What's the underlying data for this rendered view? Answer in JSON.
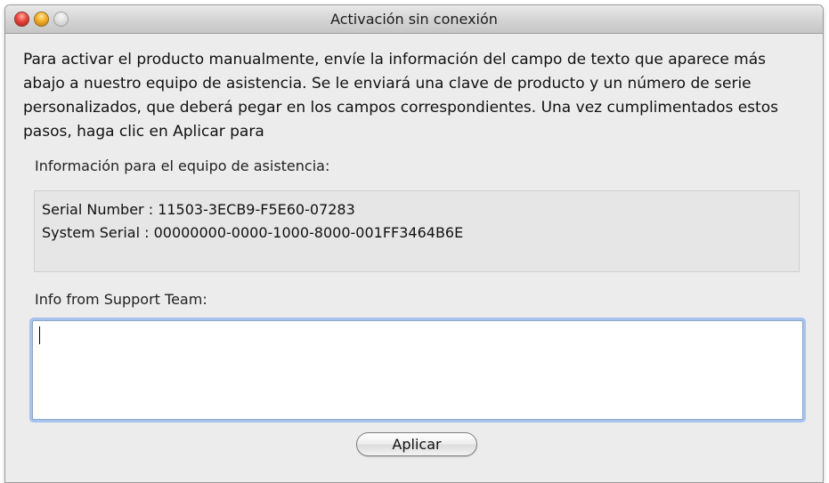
{
  "window": {
    "title": "Activación sin conexión"
  },
  "instructions": {
    "text": "Para activar el producto manualmente, envíe la información del campo de texto que aparece más abajo a nuestro equipo de asistencia. Se le enviará una clave de producto y un número de serie personalizados, que deberá pegar en los campos correspondientes. Una vez cumplimentados estos pasos, haga clic en Aplicar para"
  },
  "support_info": {
    "label": "Información para el equipo de asistencia:",
    "serial_number_line": "Serial Number : 11503-3ECB9-F5E60-07283",
    "system_serial_line": "System Serial : 00000000-0000-1000-8000-001FF3464B6E"
  },
  "support_team": {
    "label": "Info from Support Team:",
    "value": ""
  },
  "actions": {
    "apply_label": "Aplicar"
  },
  "icons": {
    "close": "close-window-icon",
    "minimize": "minimize-window-icon",
    "zoom": "zoom-window-icon"
  },
  "colors": {
    "close_button": "#e9443b",
    "minimize_button": "#f2ae27",
    "zoom_button": "#dcdcdc",
    "focus_ring": "#a7c3ec"
  }
}
